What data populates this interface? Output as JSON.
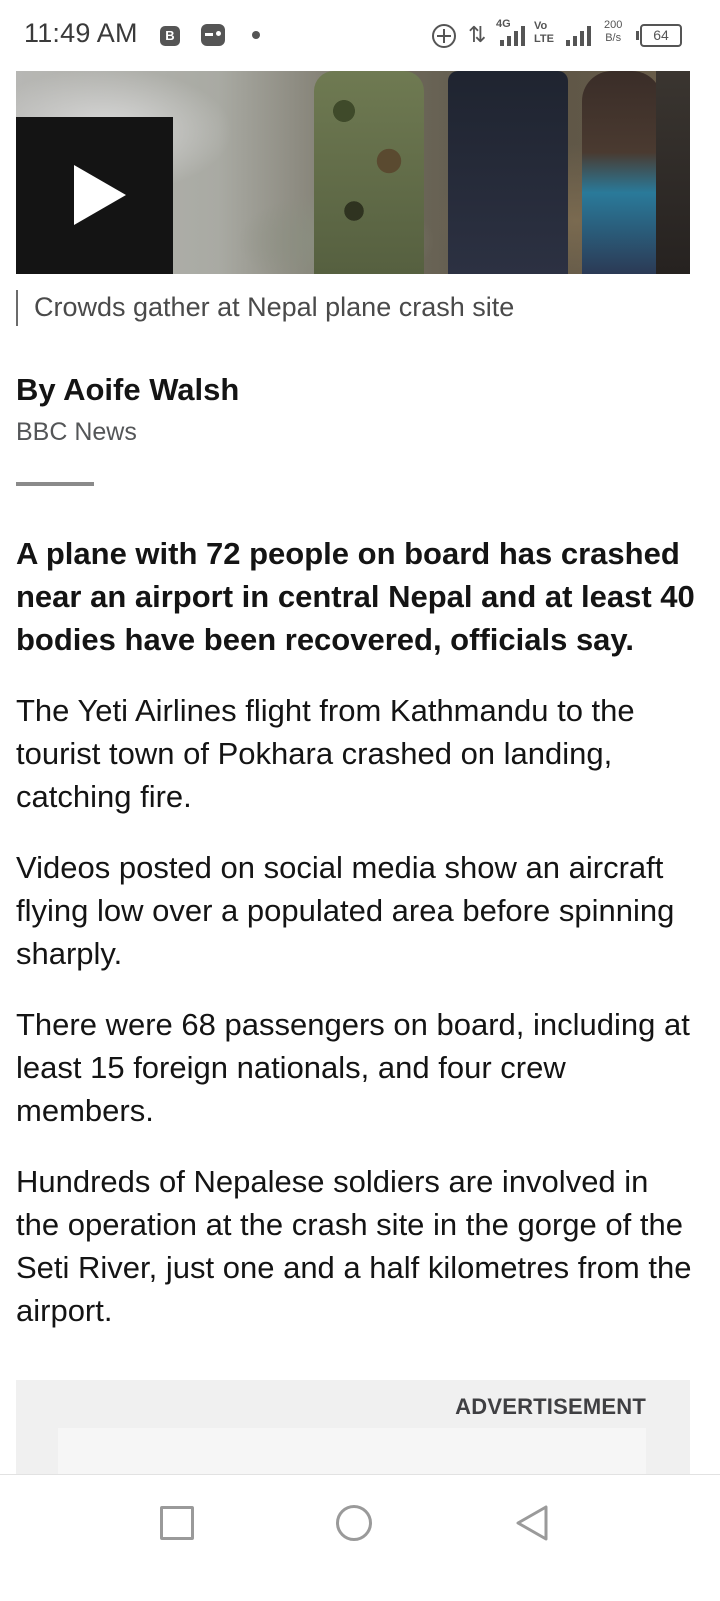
{
  "status_bar": {
    "time": "11:49 AM",
    "network_4g": "4G",
    "network_volte": "Vo LTE",
    "speed_value": "200",
    "speed_unit": "B/s",
    "battery": "64"
  },
  "video": {
    "caption": "Crowds gather at Nepal plane crash site"
  },
  "byline": {
    "author": "By Aoife Walsh",
    "outlet": "BBC News"
  },
  "article": {
    "lead": "A plane with 72 people on board has crashed near an airport in central Nepal and at least 40 bodies have been recovered, officials say.",
    "paragraphs": [
      "The Yeti Airlines flight from Kathmandu to the tourist town of Pokhara crashed on landing, catching fire.",
      "Videos posted on social media show an aircraft flying low over a populated area before spinning sharply.",
      "There were 68 passengers on board, including at least 15 foreign nationals, and four crew members.",
      "Hundreds of Nepalese soldiers are involved in the operation at the crash site in the gorge of the Seti River, just one and a half kilometres from the airport."
    ]
  },
  "advertisement": {
    "label": "ADVERTISEMENT"
  },
  "nav_bar": {
    "icons": [
      "recent-apps-icon",
      "home-icon",
      "back-icon"
    ]
  }
}
